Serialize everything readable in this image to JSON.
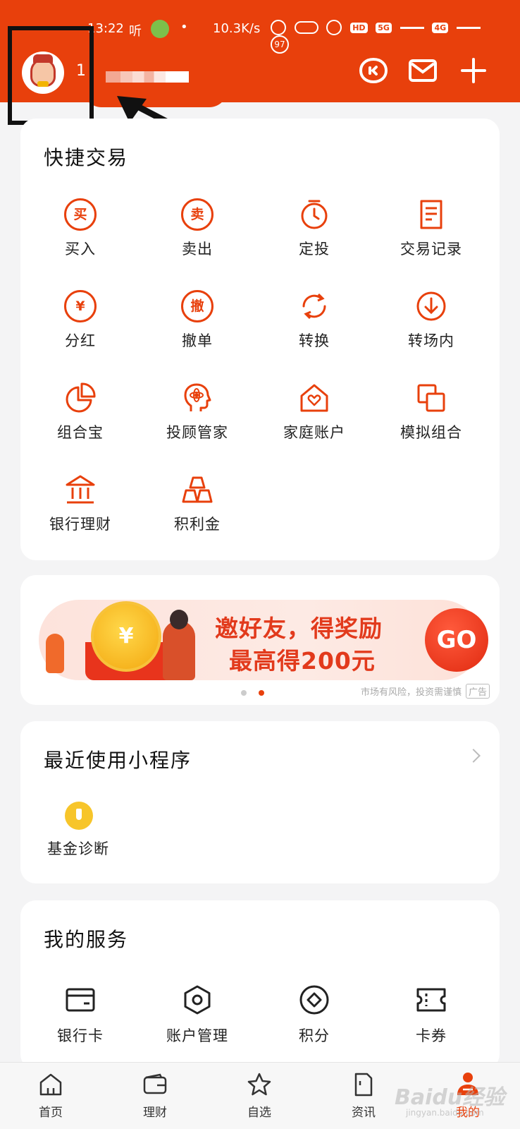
{
  "status_bar": {
    "time": "13:22",
    "listen_label": "听",
    "bullet": "•",
    "speed": "10.3K/s",
    "hd_label": "HD",
    "network_4g": "4G",
    "network_5g": "5G",
    "battery": "97"
  },
  "header": {
    "user_initial": "1"
  },
  "quick_trade": {
    "title": "快捷交易",
    "items": [
      {
        "label": "买入",
        "glyph": "买"
      },
      {
        "label": "卖出",
        "glyph": "卖"
      },
      {
        "label": "定投",
        "icon": "timer-icon"
      },
      {
        "label": "交易记录",
        "icon": "receipt-icon"
      },
      {
        "label": "分红",
        "glyph": "¥"
      },
      {
        "label": "撤单",
        "glyph": "撤"
      },
      {
        "label": "转换",
        "icon": "convert-icon"
      },
      {
        "label": "转场内",
        "icon": "download-circle-icon"
      },
      {
        "label": "组合宝",
        "icon": "pie-chart-icon"
      },
      {
        "label": "投顾管家",
        "icon": "advisor-head-icon"
      },
      {
        "label": "家庭账户",
        "icon": "home-heart-icon"
      },
      {
        "label": "模拟组合",
        "icon": "copy-squares-icon"
      },
      {
        "label": "银行理财",
        "icon": "bank-icon"
      },
      {
        "label": "积利金",
        "icon": "gold-bars-icon"
      }
    ]
  },
  "banner": {
    "title": "邀好友，得奖励",
    "subtitle": "最高得200元",
    "go_label": "GO",
    "coin_glyph": "¥",
    "disclaimer": "市场有风险，投资需谨慎",
    "ad_tag": "广告"
  },
  "recent_mini_programs": {
    "title": "最近使用小程序",
    "items": [
      {
        "label": "基金诊断"
      }
    ]
  },
  "my_services": {
    "title": "我的服务",
    "items": [
      {
        "label": "银行卡"
      },
      {
        "label": "账户管理"
      },
      {
        "label": "积分"
      },
      {
        "label": "卡券"
      }
    ]
  },
  "tabbar": {
    "items": [
      {
        "label": "首页"
      },
      {
        "label": "理财"
      },
      {
        "label": "自选"
      },
      {
        "label": "资讯"
      },
      {
        "label": "我的"
      }
    ]
  },
  "watermark": {
    "brand": "Baidu经验",
    "url": "jingyan.baidu.com"
  },
  "colors": {
    "brand": "#e8400c",
    "background": "#f4f4f5",
    "card": "#ffffff"
  }
}
